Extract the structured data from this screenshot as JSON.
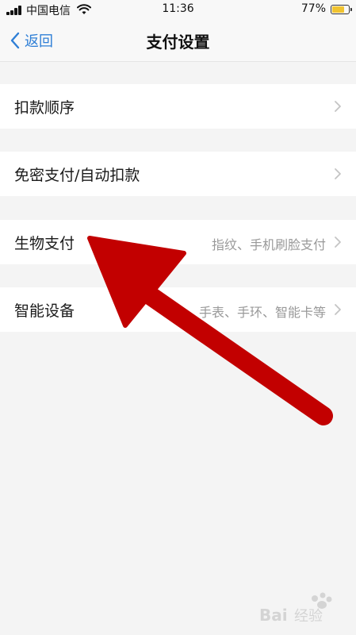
{
  "status_bar": {
    "carrier": "中国电信",
    "time": "11:36",
    "battery_percent": "77%",
    "battery_level": 0.77
  },
  "nav": {
    "back_label": "返回",
    "title": "支付设置"
  },
  "menu": [
    {
      "label": "扣款顺序",
      "value": ""
    },
    {
      "label": "免密支付/自动扣款",
      "value": ""
    },
    {
      "label": "生物支付",
      "value": "指纹、手机刷脸支付"
    },
    {
      "label": "智能设备",
      "value": "手表、手环、智能卡等"
    }
  ],
  "colors": {
    "accent": "#2f7fd6",
    "background": "#f4f4f4",
    "arrow": "#c20000",
    "battery": "#f0c330"
  },
  "icons": [
    "signal-icon",
    "wifi-icon",
    "battery-icon",
    "back-chevron-icon",
    "chevron-right-icon"
  ]
}
